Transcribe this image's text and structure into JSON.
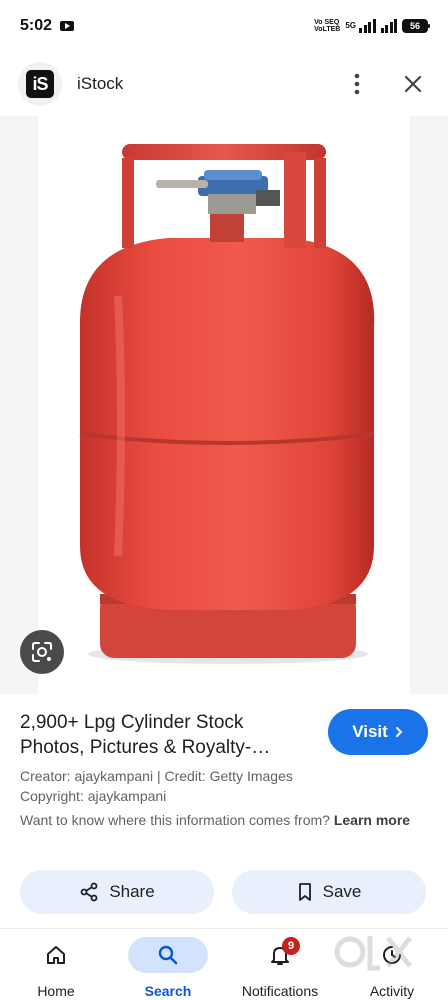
{
  "status_bar": {
    "time": "5:02",
    "network_top": "Vo SEQ",
    "network_bottom": "VoLTEB",
    "network_type": "5G",
    "battery": "56"
  },
  "header": {
    "site_logo_text": "iS",
    "site_name": "iStock"
  },
  "image": {
    "description_icon": "lpg-cylinder-photo",
    "cylinder_color": "#e84a3f"
  },
  "result": {
    "title": "2,900+ Lpg Cylinder Stock Photos, Pictures & Royalty-…",
    "visit_label": "Visit",
    "creator_line": "Creator: ajaykampani | Credit: Getty Images",
    "copyright_line": "Copyright: ajaykampani",
    "question_text": "Want to know where this information comes from? ",
    "learn_more": "Learn more",
    "share_label": "Share",
    "save_label": "Save"
  },
  "bottom_nav": {
    "items": [
      {
        "label": "Home",
        "icon": "home-icon"
      },
      {
        "label": "Search",
        "icon": "search-icon"
      },
      {
        "label": "Notifications",
        "icon": "bell-icon",
        "badge": "9"
      },
      {
        "label": "Activity",
        "icon": "activity-icon"
      }
    ],
    "active": "Search"
  },
  "colors": {
    "accent": "#1a73e8",
    "active_nav_bg": "#d3e3fd",
    "chip_bg": "#e8f0fe",
    "badge": "#c5221f"
  }
}
